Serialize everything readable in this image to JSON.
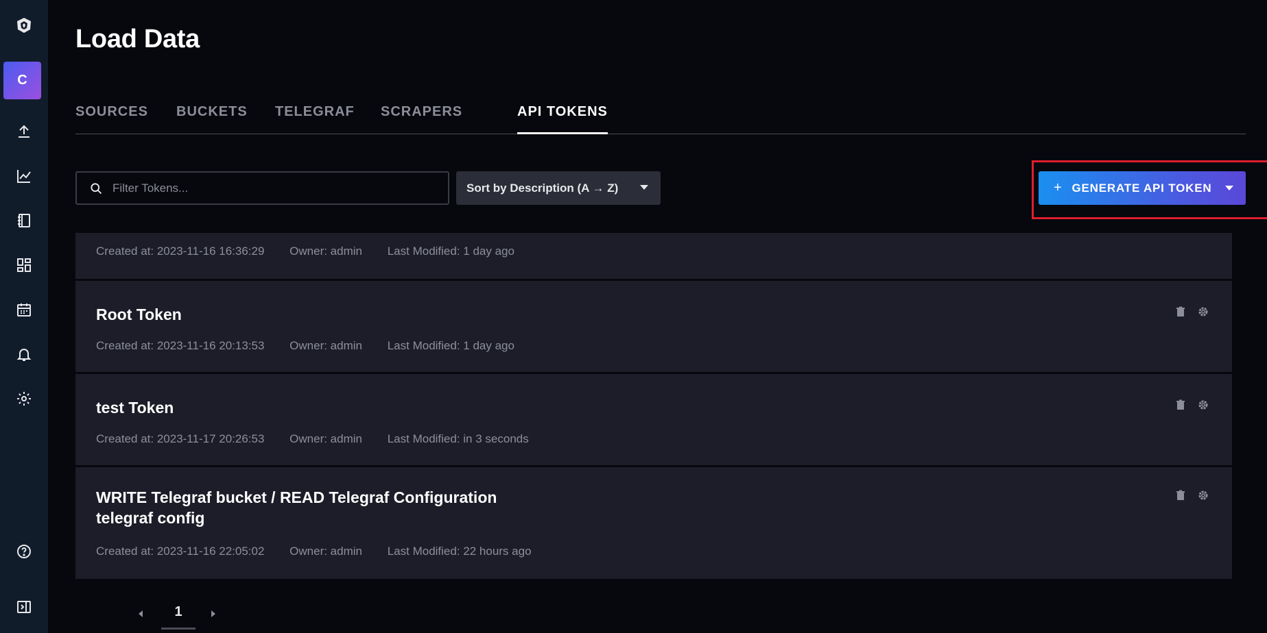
{
  "sidebar": {
    "org_initial": "C",
    "items": [
      {
        "name": "logo-icon"
      },
      {
        "name": "org-badge"
      },
      {
        "name": "upload-icon"
      },
      {
        "name": "graph-icon"
      },
      {
        "name": "notebook-icon"
      },
      {
        "name": "dashboard-icon"
      },
      {
        "name": "calendar-icon"
      },
      {
        "name": "bell-icon"
      },
      {
        "name": "gear-icon"
      },
      {
        "name": "help-icon"
      },
      {
        "name": "collapse-sidebar-icon"
      }
    ]
  },
  "page": {
    "title": "Load Data"
  },
  "tabs": [
    {
      "label": "SOURCES",
      "active": false
    },
    {
      "label": "BUCKETS",
      "active": false
    },
    {
      "label": "TELEGRAF",
      "active": false
    },
    {
      "label": "SCRAPERS",
      "active": false
    },
    {
      "label": "API TOKENS",
      "active": true
    }
  ],
  "toolbar": {
    "search_placeholder": "Filter Tokens...",
    "search_value": "",
    "sort_label": "Sort by Description (A → Z)",
    "generate_label": "GENERATE API TOKEN",
    "generate_plus": "+"
  },
  "tokens": [
    {
      "title": "",
      "created": "Created at: 2023-11-16 16:36:29",
      "owner": "Owner: admin",
      "modified": "Last Modified: 1 day ago"
    },
    {
      "title": "Root Token",
      "created": "Created at: 2023-11-16 20:13:53",
      "owner": "Owner: admin",
      "modified": "Last Modified: 1 day ago"
    },
    {
      "title": "test Token",
      "created": "Created at: 2023-11-17 20:26:53",
      "owner": "Owner: admin",
      "modified": "Last Modified: in 3 seconds"
    },
    {
      "title": "WRITE Telegraf bucket / READ Telegraf Configuration telegraf config",
      "created": "Created at: 2023-11-16 22:05:02",
      "owner": "Owner: admin",
      "modified": "Last Modified: 22 hours ago"
    }
  ],
  "pagination": {
    "current_page": "1"
  },
  "colors": {
    "accent_start": "#1a8ff0",
    "accent_end": "#5a48d8",
    "highlight_outline": "#e01e2e",
    "background": "#07080d",
    "card": "#1c1d28"
  }
}
